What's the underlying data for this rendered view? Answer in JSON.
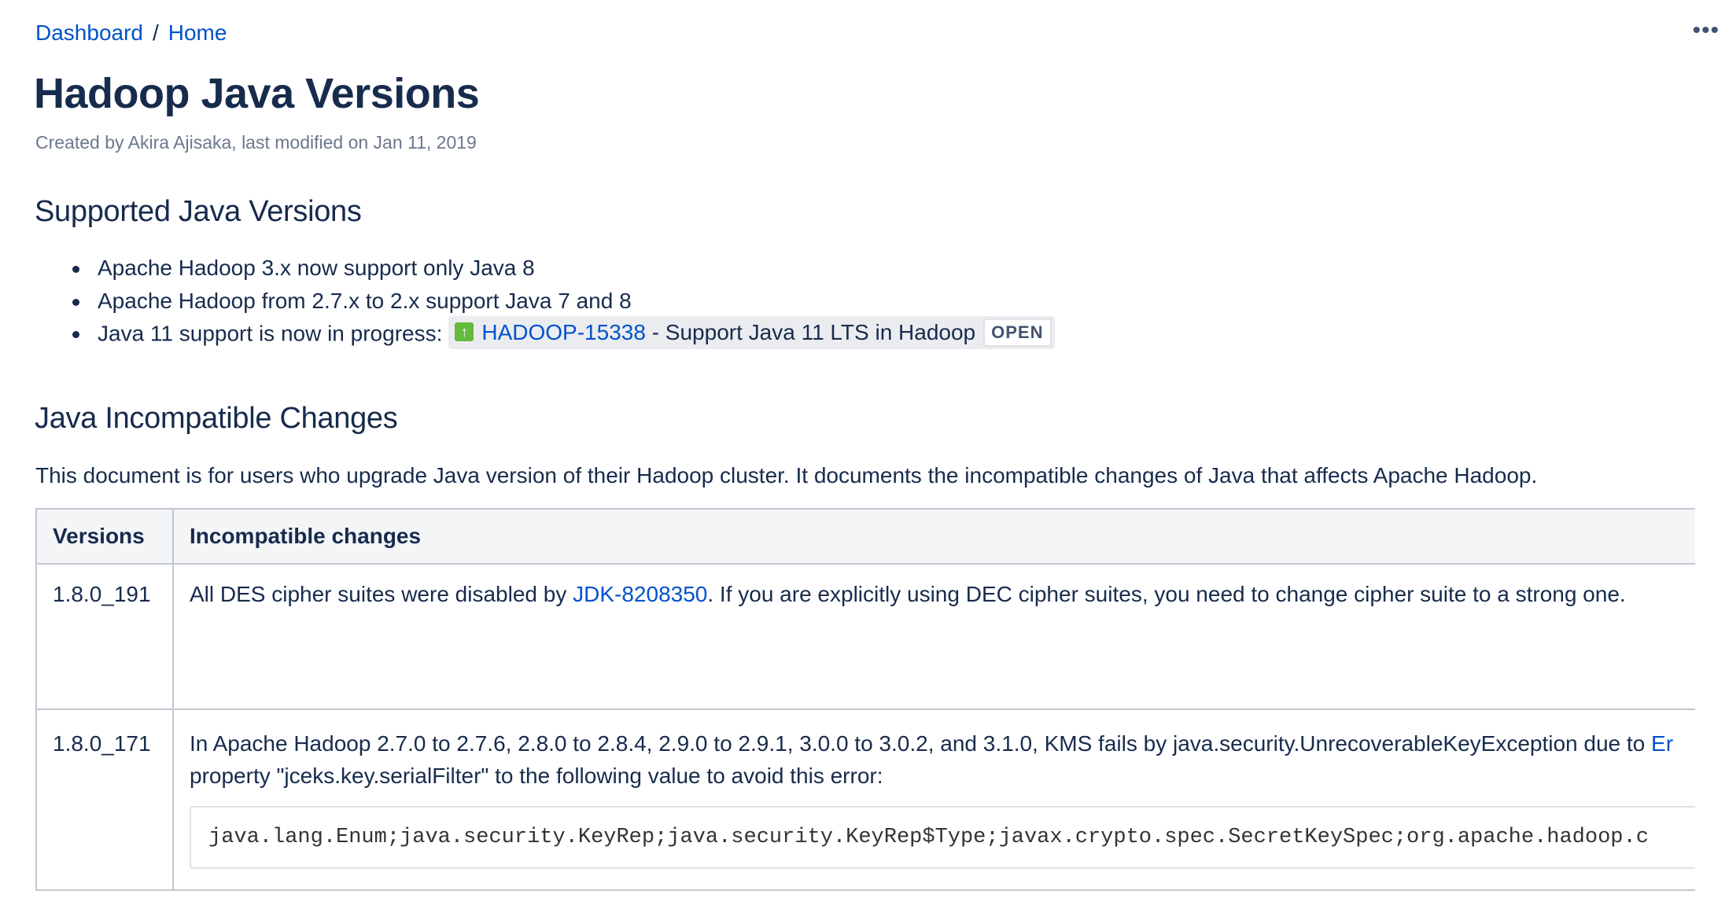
{
  "breadcrumb": [
    {
      "label": "Dashboard"
    },
    {
      "label": "Home"
    }
  ],
  "breadcrumb_separator": "/",
  "more_actions": "•••",
  "page": {
    "title": "Hadoop Java Versions",
    "meta": "Created by Akira Ajisaka, last modified on Jan 11, 2019"
  },
  "supported": {
    "heading": "Supported Java Versions",
    "items": [
      "Apache Hadoop 3.x now support only Java 8",
      "Apache Hadoop from 2.7.x to 2.x support Java 7 and 8",
      "Java 11 support is now in progress:"
    ],
    "jira": {
      "icon": "improvement-arrow-up-icon",
      "icon_color": "#63ba3c",
      "key": "HADOOP-15338",
      "summary": " - Support Java 11 LTS in Hadoop",
      "status": "OPEN"
    }
  },
  "incompatible": {
    "heading": "Java Incompatible Changes",
    "intro": "This document is for users who upgrade Java version of their Hadoop cluster. It documents the incompatible changes of Java that affects Apache Hadoop.",
    "table": {
      "headers": [
        "Versions",
        "Incompatible changes"
      ],
      "rows": [
        {
          "version": "1.8.0_191",
          "text_before": "All DES cipher suites were disabled by ",
          "link": "JDK-8208350",
          "text_after": ". If you are explicitly using DEC cipher suites, you need to change cipher suite to a strong one."
        },
        {
          "version": "1.8.0_171",
          "line1": "In Apache Hadoop 2.7.0 to 2.7.6, 2.8.0 to 2.8.4, 2.9.0 to 2.9.1, 3.0.0 to 3.0.2, and 3.1.0, KMS fails by java.security.UnrecoverableKeyException due to ",
          "line1_link": "Er",
          "line2": "property \"jceks.key.serialFilter\" to the following value to avoid this error:",
          "code": "java.lang.Enum;java.security.KeyRep;java.security.KeyRep$Type;javax.crypto.spec.SecretKeySpec;org.apache.hadoop.c"
        }
      ]
    }
  },
  "colors": {
    "link": "#0052cc",
    "text": "#172b4d",
    "muted": "#6b778c",
    "header_bg": "#f4f5f7",
    "border": "#c1c7d0"
  }
}
